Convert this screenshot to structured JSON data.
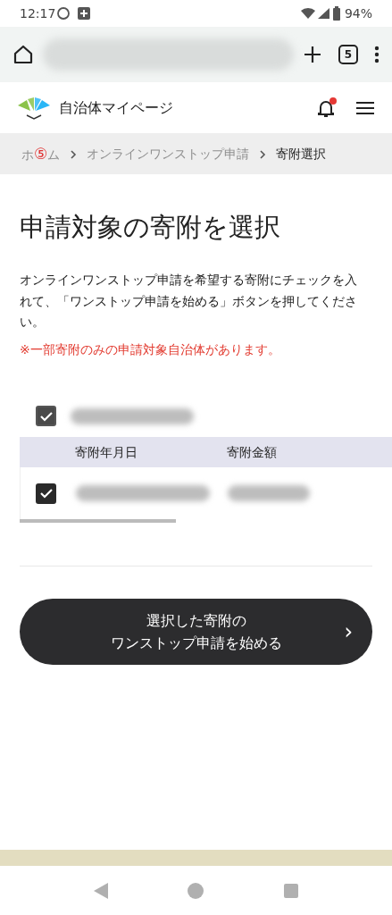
{
  "status_bar": {
    "time": "12:17",
    "battery": "94%"
  },
  "browser": {
    "tab_count": "5"
  },
  "header": {
    "site_name": "自治体マイページ",
    "has_notification": true
  },
  "breadcrumb": {
    "first": {
      "label_before": "ホ",
      "marker": "⑤",
      "label_after": "ム"
    },
    "items": [
      {
        "label": "オンラインワンストップ申請",
        "current": false
      },
      {
        "label": "寄附選択",
        "current": true
      }
    ]
  },
  "page_title": "申請対象の寄附を選択",
  "instructions": "オンラインワンストップ申請を希望する寄附にチェックを入れて、「ワンストップ申請を始める」ボタンを押してください。",
  "notice": "※一部寄附のみの申請対象自治体があります。",
  "municipality": {
    "checked": true
  },
  "table": {
    "columns": [
      "寄附年月日",
      "寄附金額"
    ],
    "rows": [
      {
        "checked": true
      }
    ]
  },
  "start_button": {
    "line1": "選択した寄附の",
    "line2": "ワンストップ申請を始める",
    "arrow": "›"
  }
}
